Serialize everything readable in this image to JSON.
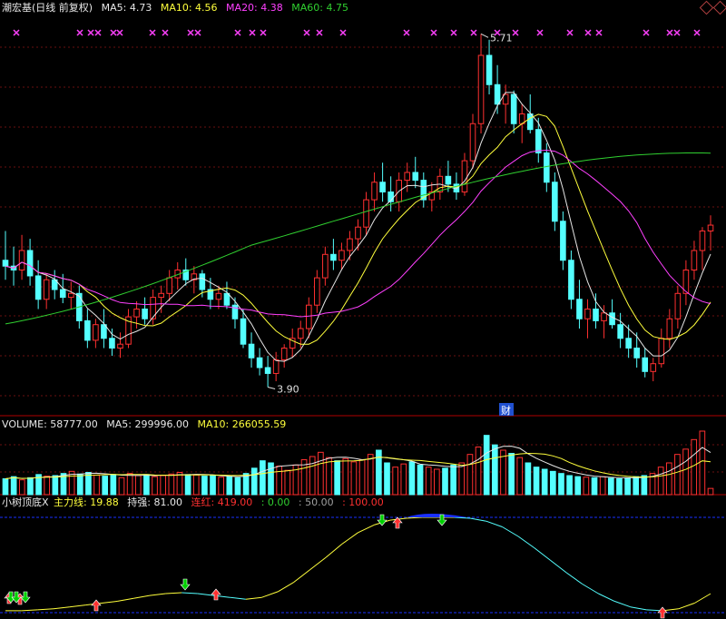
{
  "colors": {
    "background": "#000000",
    "up": "#ff3030",
    "down": "#54ffff",
    "white": "#e0e0e0",
    "ma5": "#e6e6e6",
    "ma10": "#ffff3c",
    "ma20": "#ff40ff",
    "ma60": "#30d030",
    "pane_border": "#b00000",
    "grid": "#6a1010",
    "blue_ref": "#1a30ff",
    "cross": "#ff40ff",
    "buy_arrow": "#ff3030",
    "sell_arrow": "#00d000"
  },
  "price_panel": {
    "title": "潮宏基(日线 前复权)",
    "ma5": {
      "label": "MA5:",
      "value": "4.73"
    },
    "ma10": {
      "label": "MA10:",
      "value": "4.56"
    },
    "ma20": {
      "label": "MA20:",
      "value": "4.38"
    },
    "ma60": {
      "label": "MA60:",
      "value": "4.75"
    },
    "high_label": "5.71",
    "low_label": "3.90",
    "event_badge": "财"
  },
  "volume_panel": {
    "label": "VOLUME:",
    "value": "58777.00",
    "ma5_label": "MA5:",
    "ma5": "299996.00",
    "ma10_label": "MA10:",
    "ma10": "266055.59"
  },
  "indicator_panel": {
    "name": "小树顶底X",
    "main_label": "主力线:",
    "main": "19.88",
    "hold_label": "持强:",
    "hold": "81.00",
    "streak_label": "连红:",
    "streak": "419.00",
    "lev0": ": 0.00",
    "lev50": ": 50.00",
    "lev100": ": 100.00"
  },
  "chart_data": [
    {
      "type": "candlestick",
      "title": "潮宏基(日线 前复权)",
      "ylim": [
        3.8,
        5.8
      ],
      "annotations": [
        {
          "text": "5.71",
          "value": 5.71
        },
        {
          "text": "3.90",
          "value": 3.9
        }
      ],
      "ohlc": [
        [
          4.55,
          4.7,
          4.45,
          4.52
        ],
        [
          4.52,
          4.62,
          4.42,
          4.5
        ],
        [
          4.5,
          4.68,
          4.45,
          4.6
        ],
        [
          4.6,
          4.66,
          4.42,
          4.47
        ],
        [
          4.47,
          4.55,
          4.3,
          4.35
        ],
        [
          4.35,
          4.48,
          4.3,
          4.45
        ],
        [
          4.45,
          4.5,
          4.35,
          4.4
        ],
        [
          4.4,
          4.48,
          4.33,
          4.36
        ],
        [
          4.36,
          4.44,
          4.3,
          4.38
        ],
        [
          4.38,
          4.42,
          4.2,
          4.24
        ],
        [
          4.24,
          4.3,
          4.1,
          4.14
        ],
        [
          4.14,
          4.25,
          4.1,
          4.22
        ],
        [
          4.22,
          4.3,
          4.1,
          4.15
        ],
        [
          4.15,
          4.2,
          4.06,
          4.1
        ],
        [
          4.1,
          4.18,
          4.05,
          4.12
        ],
        [
          4.12,
          4.3,
          4.1,
          4.26
        ],
        [
          4.26,
          4.34,
          4.2,
          4.3
        ],
        [
          4.3,
          4.36,
          4.22,
          4.25
        ],
        [
          4.25,
          4.4,
          4.22,
          4.36
        ],
        [
          4.36,
          4.42,
          4.28,
          4.38
        ],
        [
          4.38,
          4.5,
          4.34,
          4.46
        ],
        [
          4.46,
          4.54,
          4.4,
          4.5
        ],
        [
          4.5,
          4.56,
          4.42,
          4.45
        ],
        [
          4.45,
          4.52,
          4.38,
          4.48
        ],
        [
          4.48,
          4.5,
          4.36,
          4.4
        ],
        [
          4.4,
          4.46,
          4.3,
          4.35
        ],
        [
          4.35,
          4.42,
          4.3,
          4.38
        ],
        [
          4.38,
          4.44,
          4.3,
          4.32
        ],
        [
          4.32,
          4.36,
          4.2,
          4.25
        ],
        [
          4.25,
          4.3,
          4.1,
          4.12
        ],
        [
          4.12,
          4.18,
          4.0,
          4.05
        ],
        [
          4.05,
          4.1,
          3.96,
          4.0
        ],
        [
          4.0,
          4.06,
          3.9,
          3.97
        ],
        [
          3.97,
          4.08,
          3.93,
          4.04
        ],
        [
          4.04,
          4.12,
          4.0,
          4.1
        ],
        [
          4.1,
          4.2,
          4.05,
          4.15
        ],
        [
          4.15,
          4.24,
          4.1,
          4.2
        ],
        [
          4.2,
          4.36,
          4.15,
          4.32
        ],
        [
          4.32,
          4.5,
          4.28,
          4.46
        ],
        [
          4.46,
          4.62,
          4.42,
          4.58
        ],
        [
          4.58,
          4.66,
          4.5,
          4.55
        ],
        [
          4.55,
          4.64,
          4.5,
          4.6
        ],
        [
          4.6,
          4.7,
          4.55,
          4.66
        ],
        [
          4.66,
          4.76,
          4.6,
          4.72
        ],
        [
          4.72,
          4.9,
          4.68,
          4.86
        ],
        [
          4.86,
          5.0,
          4.8,
          4.95
        ],
        [
          4.95,
          5.05,
          4.85,
          4.9
        ],
        [
          4.9,
          4.98,
          4.8,
          4.85
        ],
        [
          4.85,
          5.0,
          4.8,
          4.96
        ],
        [
          4.96,
          5.05,
          4.9,
          5.0
        ],
        [
          5.0,
          5.08,
          4.92,
          4.96
        ],
        [
          4.96,
          5.0,
          4.82,
          4.86
        ],
        [
          4.86,
          4.95,
          4.8,
          4.9
        ],
        [
          4.9,
          5.02,
          4.86,
          4.98
        ],
        [
          4.98,
          5.06,
          4.9,
          4.94
        ],
        [
          4.94,
          5.0,
          4.86,
          4.9
        ],
        [
          4.9,
          5.1,
          4.88,
          5.06
        ],
        [
          5.06,
          5.3,
          5.02,
          5.25
        ],
        [
          5.25,
          5.71,
          5.2,
          5.6
        ],
        [
          5.6,
          5.68,
          5.4,
          5.45
        ],
        [
          5.45,
          5.55,
          5.3,
          5.35
        ],
        [
          5.35,
          5.45,
          5.25,
          5.4
        ],
        [
          5.4,
          5.42,
          5.2,
          5.25
        ],
        [
          5.25,
          5.35,
          5.15,
          5.3
        ],
        [
          5.3,
          5.4,
          5.2,
          5.22
        ],
        [
          5.22,
          5.28,
          5.05,
          5.1
        ],
        [
          5.1,
          5.15,
          4.9,
          4.95
        ],
        [
          4.95,
          5.0,
          4.7,
          4.75
        ],
        [
          4.75,
          4.8,
          4.5,
          4.55
        ],
        [
          4.55,
          4.6,
          4.3,
          4.35
        ],
        [
          4.35,
          4.45,
          4.2,
          4.25
        ],
        [
          4.25,
          4.35,
          4.15,
          4.3
        ],
        [
          4.3,
          4.38,
          4.2,
          4.24
        ],
        [
          4.24,
          4.32,
          4.15,
          4.28
        ],
        [
          4.28,
          4.35,
          4.2,
          4.22
        ],
        [
          4.22,
          4.28,
          4.1,
          4.15
        ],
        [
          4.15,
          4.22,
          4.05,
          4.1
        ],
        [
          4.1,
          4.18,
          4.0,
          4.05
        ],
        [
          4.05,
          4.1,
          3.95,
          3.98
        ],
        [
          3.98,
          4.05,
          3.93,
          4.02
        ],
        [
          4.02,
          4.2,
          4.0,
          4.15
        ],
        [
          4.15,
          4.3,
          4.1,
          4.25
        ],
        [
          4.25,
          4.42,
          4.2,
          4.38
        ],
        [
          4.38,
          4.55,
          4.32,
          4.5
        ],
        [
          4.5,
          4.65,
          4.45,
          4.6
        ],
        [
          4.6,
          4.72,
          4.5,
          4.7
        ],
        [
          4.7,
          4.78,
          4.6,
          4.73
        ]
      ],
      "ma_values": {
        "MA5": 4.73,
        "MA10": 4.56,
        "MA20": 4.38,
        "MA60": 4.75
      }
    },
    {
      "type": "bar",
      "title": "VOLUME",
      "values": [
        150000,
        170000,
        140000,
        160000,
        190000,
        175000,
        180000,
        200000,
        220000,
        195000,
        210000,
        185000,
        175000,
        190000,
        160000,
        200000,
        180000,
        190000,
        170000,
        180000,
        195000,
        210000,
        190000,
        185000,
        175000,
        180000,
        165000,
        170000,
        160000,
        200000,
        250000,
        320000,
        300000,
        270000,
        230000,
        280000,
        330000,
        360000,
        400000,
        350000,
        320000,
        340000,
        310000,
        330000,
        380000,
        420000,
        300000,
        260000,
        290000,
        310000,
        280000,
        260000,
        240000,
        250000,
        280000,
        300000,
        380000,
        450000,
        560000,
        470000,
        420000,
        390000,
        350000,
        300000,
        260000,
        240000,
        220000,
        200000,
        180000,
        170000,
        165000,
        160000,
        170000,
        155000,
        150000,
        160000,
        170000,
        180000,
        200000,
        260000,
        300000,
        380000,
        430000,
        520000,
        600000,
        58777
      ],
      "series": [
        {
          "name": "MA5",
          "last": 299996.0
        },
        {
          "name": "MA10",
          "last": 266055.59
        }
      ]
    },
    {
      "type": "line",
      "title": "小树顶底X",
      "ylim": [
        0,
        100
      ],
      "reference_lines": [
        0,
        50,
        100
      ],
      "series": [
        {
          "name": "主力线",
          "values": [
            2,
            2,
            3,
            4,
            6,
            8,
            10,
            12,
            15,
            18,
            20,
            21,
            20,
            18,
            16,
            14,
            16,
            22,
            32,
            45,
            58,
            72,
            84,
            92,
            97,
            99,
            100,
            100,
            100,
            99,
            96,
            90,
            80,
            68,
            55,
            42,
            30,
            20,
            12,
            6,
            3,
            2,
            4,
            10,
            19.88
          ]
        }
      ]
    }
  ]
}
